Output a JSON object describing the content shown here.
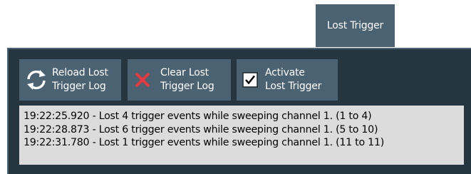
{
  "tab": {
    "label": "Lost Trigger"
  },
  "buttons": {
    "reload": {
      "line1": "Reload Lost",
      "line2": "Trigger Log",
      "icon": "refresh-icon"
    },
    "clear": {
      "line1": "Clear Lost",
      "line2": "Trigger Log",
      "icon": "close-icon"
    },
    "activate": {
      "line1": "Activate",
      "line2": "Lost Trigger",
      "icon": "checkbox-checked-icon",
      "checked": true
    }
  },
  "log": {
    "lines": [
      "19:22:25.920 - Lost 4 trigger events while sweeping channel 1. (1 to 4)",
      "19:22:28.873 - Lost 6 trigger events while sweeping channel 1. (5 to 10)",
      "19:22:31.780 - Lost 1 trigger events while sweeping channel 1. (11 to 11)"
    ]
  },
  "colors": {
    "panel_bg": "#263641",
    "button_bg": "#4a6272",
    "clear_icon_red": "#e8383d",
    "log_bg": "#dcdcdc"
  }
}
